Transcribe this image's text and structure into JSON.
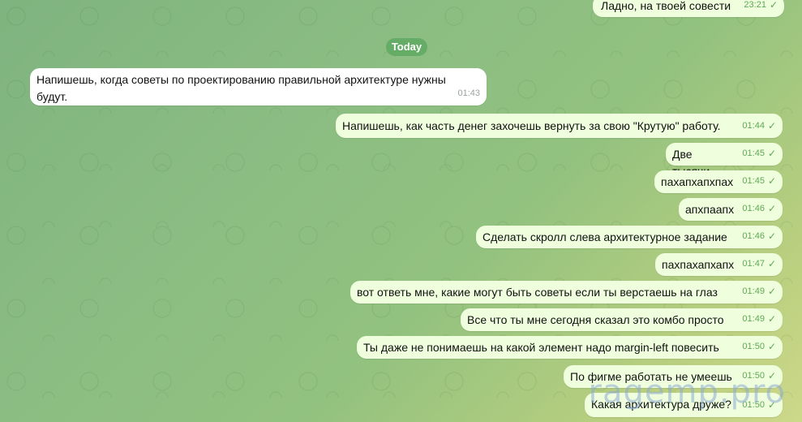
{
  "date_separator": "Today",
  "messages": [
    {
      "text": "Ладно, на твоей совести",
      "time": "23:21",
      "dir": "out"
    },
    {
      "text": "Напишешь, когда советы по проектированию правильной архитектуре нужны будут.",
      "time": "01:43",
      "dir": "in"
    },
    {
      "text": "Напишешь, как часть денег захочешь вернуть за свою \"Крутую\" работу.",
      "time": "01:44",
      "dir": "out"
    },
    {
      "text": "Две тысячи",
      "time": "01:45",
      "dir": "out"
    },
    {
      "text": "пахапхапхпах",
      "time": "01:45",
      "dir": "out"
    },
    {
      "text": "апхпаапх",
      "time": "01:46",
      "dir": "out"
    },
    {
      "text": "Сделать скролл слева архитектурное задание",
      "time": "01:46",
      "dir": "out"
    },
    {
      "text": "пахпахапхапх",
      "time": "01:47",
      "dir": "out"
    },
    {
      "text": "вот ответь мне, какие могут быть советы если ты верстаешь на глаз",
      "time": "01:49",
      "dir": "out"
    },
    {
      "text": "Все что ты мне сегодня сказал это комбо просто",
      "time": "01:49",
      "dir": "out"
    },
    {
      "text": "Ты даже не понимаешь на какой элемент надо margin-left повесить",
      "time": "01:50",
      "dir": "out"
    },
    {
      "text": "По фигме работать не умеешь",
      "time": "01:50",
      "dir": "out"
    },
    {
      "text": "Какая архитектура друже?",
      "time": "01:50",
      "dir": "out"
    }
  ],
  "watermark": "ragemp.pro",
  "colors": {
    "outgoing_bubble": "#effedd",
    "incoming_bubble": "#ffffff",
    "accent": "#5fa856",
    "date_pill": "#65ad66"
  }
}
